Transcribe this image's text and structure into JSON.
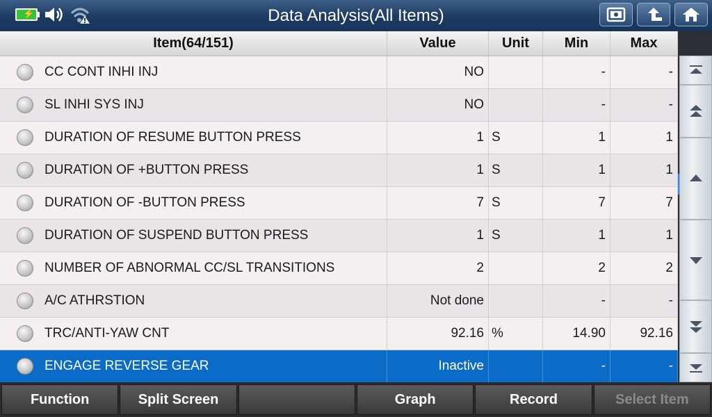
{
  "title": "Data Analysis(All Items)",
  "status_icons": [
    "battery-charging-icon",
    "speaker-icon",
    "wifi-warning-icon"
  ],
  "title_buttons": [
    "screenshot-icon",
    "back-icon",
    "home-icon"
  ],
  "columns": {
    "item": "Item(64/151)",
    "value": "Value",
    "unit": "Unit",
    "min": "Min",
    "max": "Max"
  },
  "rows": [
    {
      "item": "CC CONT INHI INJ",
      "value": "NO",
      "unit": "",
      "min": "-",
      "max": "-"
    },
    {
      "item": "SL INHI SYS INJ",
      "value": "NO",
      "unit": "",
      "min": "-",
      "max": "-"
    },
    {
      "item": "DURATION OF RESUME BUTTON PRESS",
      "value": "1",
      "unit": "S",
      "min": "1",
      "max": "1"
    },
    {
      "item": "DURATION OF +BUTTON PRESS",
      "value": "1",
      "unit": "S",
      "min": "1",
      "max": "1"
    },
    {
      "item": "DURATION OF -BUTTON PRESS",
      "value": "7",
      "unit": "S",
      "min": "7",
      "max": "7"
    },
    {
      "item": "DURATION OF SUSPEND BUTTON PRESS",
      "value": "1",
      "unit": "S",
      "min": "1",
      "max": "1"
    },
    {
      "item": "NUMBER OF ABNORMAL CC/SL TRANSITIONS",
      "value": "2",
      "unit": "",
      "min": "2",
      "max": "2"
    },
    {
      "item": "A/C ATHRSTION",
      "value": "Not done",
      "unit": "",
      "min": "-",
      "max": "-"
    },
    {
      "item": "TRC/ANTI-YAW CNT",
      "value": "92.16",
      "unit": "%",
      "min": "14.90",
      "max": "92.16"
    },
    {
      "item": "ENGAGE REVERSE GEAR",
      "value": "Inactive",
      "unit": "",
      "min": "-",
      "max": "-"
    }
  ],
  "scroll_buttons": [
    "scroll-top-icon",
    "page-up-icon",
    "line-up-icon",
    "line-down-icon",
    "page-down-icon",
    "scroll-bottom-icon"
  ],
  "bottom": {
    "function": "Function",
    "split_screen": "Split Screen",
    "blank": "",
    "graph": "Graph",
    "record": "Record",
    "select_item": "Select Item"
  },
  "colors": {
    "selected_row": "#0b6cc7",
    "title_bar": "#1f3d63",
    "battery": "#38c23a"
  }
}
